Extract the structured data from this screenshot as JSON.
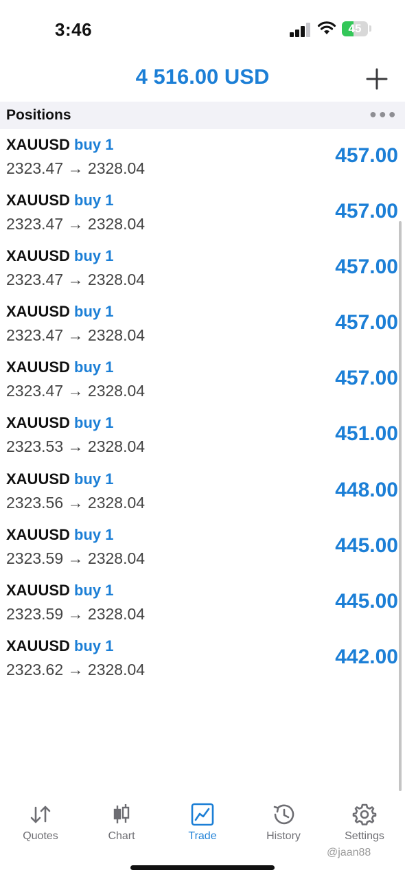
{
  "status_bar": {
    "time": "3:46",
    "battery": "45"
  },
  "header": {
    "balance": "4 516.00 USD"
  },
  "section": {
    "title": "Positions"
  },
  "positions": [
    {
      "symbol": "XAUUSD",
      "action": "buy 1",
      "open_price": "2323.47",
      "current_price": "2328.04",
      "profit": "457.00"
    },
    {
      "symbol": "XAUUSD",
      "action": "buy 1",
      "open_price": "2323.47",
      "current_price": "2328.04",
      "profit": "457.00"
    },
    {
      "symbol": "XAUUSD",
      "action": "buy 1",
      "open_price": "2323.47",
      "current_price": "2328.04",
      "profit": "457.00"
    },
    {
      "symbol": "XAUUSD",
      "action": "buy 1",
      "open_price": "2323.47",
      "current_price": "2328.04",
      "profit": "457.00"
    },
    {
      "symbol": "XAUUSD",
      "action": "buy 1",
      "open_price": "2323.47",
      "current_price": "2328.04",
      "profit": "457.00"
    },
    {
      "symbol": "XAUUSD",
      "action": "buy 1",
      "open_price": "2323.53",
      "current_price": "2328.04",
      "profit": "451.00"
    },
    {
      "symbol": "XAUUSD",
      "action": "buy 1",
      "open_price": "2323.56",
      "current_price": "2328.04",
      "profit": "448.00"
    },
    {
      "symbol": "XAUUSD",
      "action": "buy 1",
      "open_price": "2323.59",
      "current_price": "2328.04",
      "profit": "445.00"
    },
    {
      "symbol": "XAUUSD",
      "action": "buy 1",
      "open_price": "2323.59",
      "current_price": "2328.04",
      "profit": "445.00"
    },
    {
      "symbol": "XAUUSD",
      "action": "buy 1",
      "open_price": "2323.62",
      "current_price": "2328.04",
      "profit": "442.00"
    }
  ],
  "tabs": [
    {
      "label": "Quotes",
      "icon": "quotes-arrows-icon",
      "active": false
    },
    {
      "label": "Chart",
      "icon": "candlestick-icon",
      "active": false
    },
    {
      "label": "Trade",
      "icon": "trade-chart-icon",
      "active": true
    },
    {
      "label": "History",
      "icon": "history-clock-icon",
      "active": false
    },
    {
      "label": "Settings",
      "icon": "gear-icon",
      "active": false
    }
  ],
  "watermark": "@jaan88",
  "colors": {
    "accent": "#1c7fd6",
    "battery": "#34c759"
  }
}
